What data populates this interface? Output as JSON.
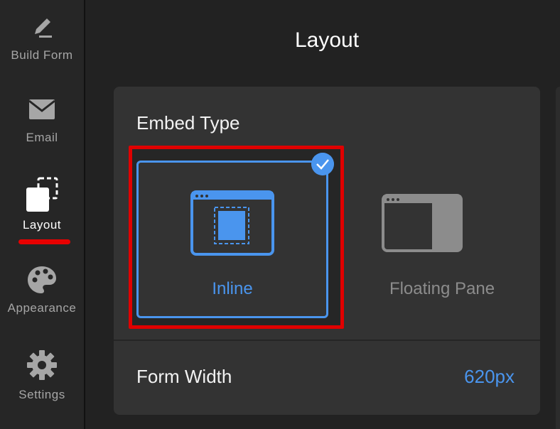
{
  "sidebar": {
    "items": [
      {
        "label": "Build Form",
        "icon": "pencil-icon"
      },
      {
        "label": "Email",
        "icon": "envelope-icon"
      },
      {
        "label": "Layout",
        "icon": "layout-icon",
        "active": true
      },
      {
        "label": "Appearance",
        "icon": "palette-icon"
      },
      {
        "label": "Settings",
        "icon": "gear-icon"
      }
    ]
  },
  "main": {
    "title": "Layout",
    "embed_type": {
      "title": "Embed Type",
      "options": [
        {
          "label": "Inline",
          "icon": "inline-embed-icon",
          "selected": true
        },
        {
          "label": "Floating Pane",
          "icon": "floating-pane-icon",
          "selected": false
        }
      ]
    },
    "form_width": {
      "label": "Form Width",
      "value": "620px"
    }
  },
  "colors": {
    "accent": "#4a95ee",
    "highlight": "#e00000",
    "panel": "#333333",
    "background": "#222222"
  }
}
